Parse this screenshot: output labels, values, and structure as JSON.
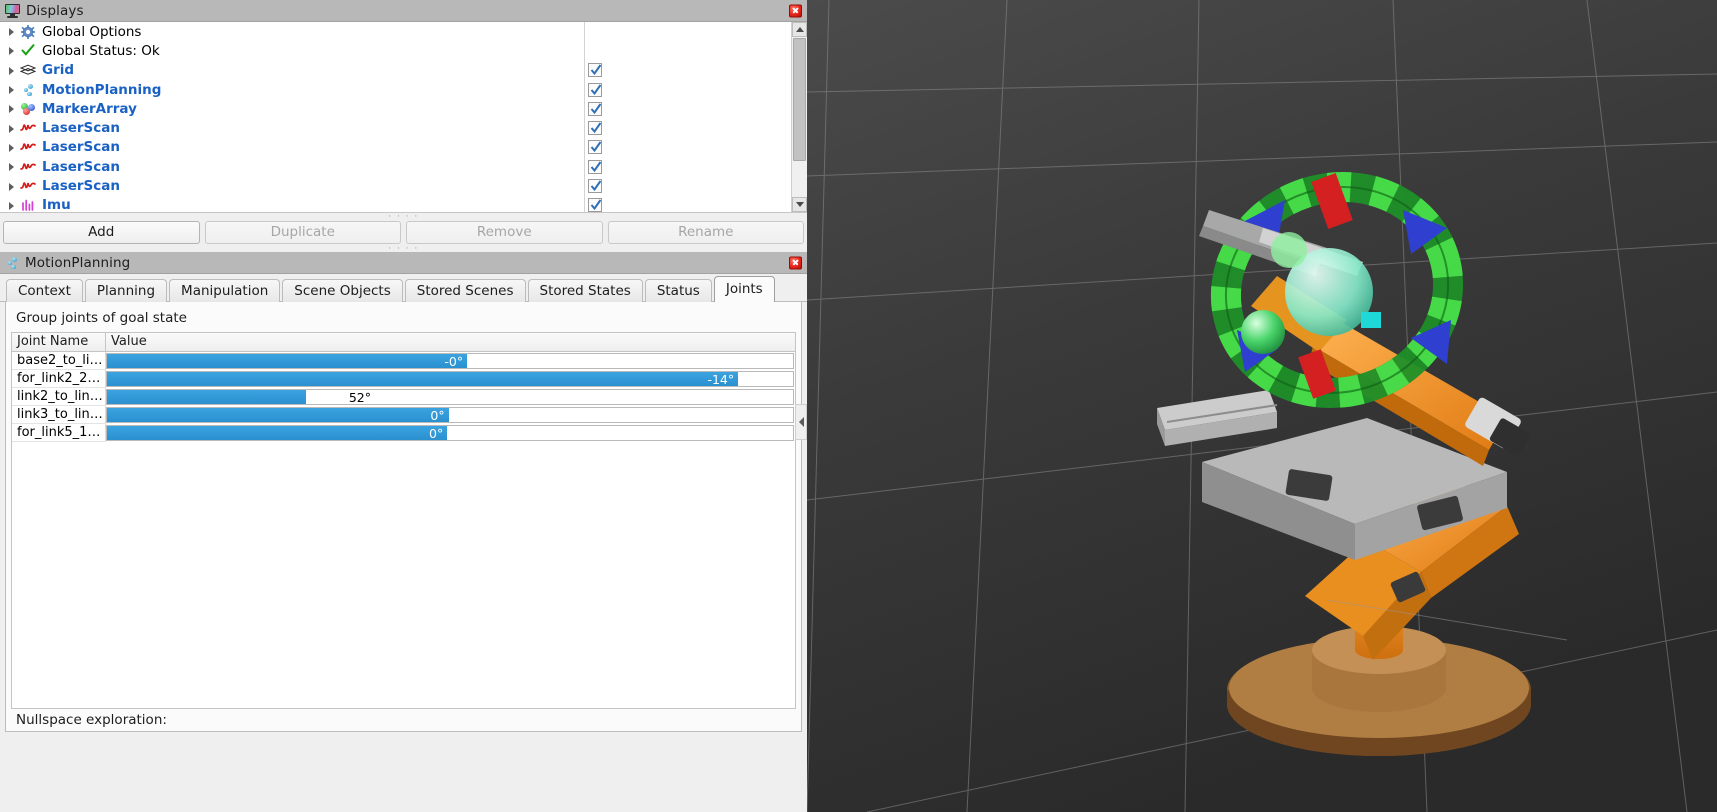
{
  "displays_panel": {
    "title": "Displays",
    "title_icon": "monitor-icon",
    "close_icon": "close-icon",
    "tree": [
      {
        "label": "Global Options",
        "icon": "gear-icon",
        "style": "plain",
        "checkbox": null
      },
      {
        "label": "Global Status: Ok",
        "icon": "check-icon",
        "style": "plain",
        "checkbox": null
      },
      {
        "label": "Grid",
        "icon": "grid-icon",
        "style": "link",
        "checkbox": true
      },
      {
        "label": "MotionPlanning",
        "icon": "moveit-icon",
        "style": "link",
        "checkbox": true
      },
      {
        "label": "MarkerArray",
        "icon": "marker-array-icon",
        "style": "link",
        "checkbox": true
      },
      {
        "label": "LaserScan",
        "icon": "laser-scan-icon",
        "style": "link",
        "checkbox": true
      },
      {
        "label": "LaserScan",
        "icon": "laser-scan-icon",
        "style": "link",
        "checkbox": true
      },
      {
        "label": "LaserScan",
        "icon": "laser-scan-icon",
        "style": "link",
        "checkbox": true
      },
      {
        "label": "LaserScan",
        "icon": "laser-scan-icon",
        "style": "link",
        "checkbox": true
      },
      {
        "label": "Imu",
        "icon": "imu-icon",
        "style": "link",
        "checkbox": true
      }
    ],
    "buttons": [
      {
        "label": "Add",
        "enabled": true
      },
      {
        "label": "Duplicate",
        "enabled": false
      },
      {
        "label": "Remove",
        "enabled": false
      },
      {
        "label": "Rename",
        "enabled": false
      }
    ]
  },
  "motion_planning_panel": {
    "title": "MotionPlanning",
    "title_icon": "moveit-icon",
    "close_icon": "close-icon",
    "tabs": [
      {
        "label": "Context",
        "active": false
      },
      {
        "label": "Planning",
        "active": false
      },
      {
        "label": "Manipulation",
        "active": false
      },
      {
        "label": "Scene Objects",
        "active": false
      },
      {
        "label": "Stored Scenes",
        "active": false
      },
      {
        "label": "Stored States",
        "active": false
      },
      {
        "label": "Status",
        "active": false
      },
      {
        "label": "Joints",
        "active": true
      }
    ],
    "joints_tab": {
      "group_label": "Group joints of goal state",
      "columns": [
        "Joint Name",
        "Value"
      ],
      "rows": [
        {
          "name": "base2_to_li…",
          "value": "-0°",
          "fill_percent": 52.5,
          "label_inside": true
        },
        {
          "name": "for_link2_2…",
          "value": "-14°",
          "fill_percent": 92.0,
          "label_inside": true
        },
        {
          "name": "link2_to_lin…",
          "value": "52°",
          "fill_percent": 29.0,
          "label_inside": false
        },
        {
          "name": "link3_to_lin…",
          "value": "0°",
          "fill_percent": 49.8,
          "label_inside": true
        },
        {
          "name": "for_link5_1…",
          "value": "0°",
          "fill_percent": 49.6,
          "label_inside": true
        }
      ],
      "nullspace_label": "Nullspace exploration:"
    }
  },
  "viewport": {
    "name": "3d-view",
    "collapse_icon": "chevron-right-icon"
  },
  "colors": {
    "accent_blue": "#2b90d0",
    "link_blue": "#1a61c4",
    "titlebar_gray": "#b8b8b8",
    "close_red": "#e8271c"
  }
}
